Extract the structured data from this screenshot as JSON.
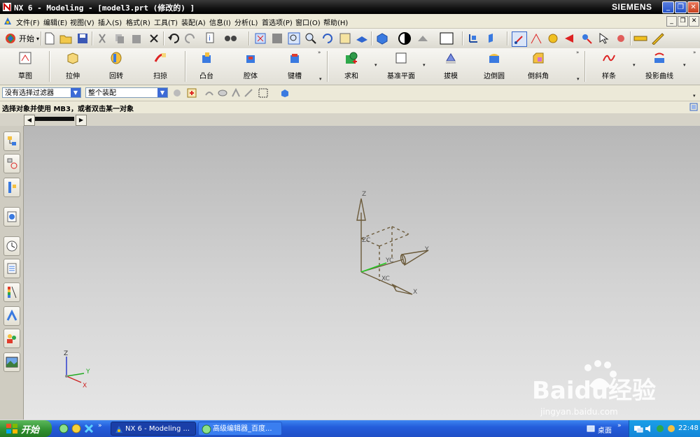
{
  "window": {
    "title": "NX 6 - Modeling - [model3.prt  (修改的) ]",
    "brand": "SIEMENS",
    "controls": {
      "minimize": "_",
      "restore": "❐",
      "close": "✕"
    }
  },
  "menu": {
    "items": [
      "文件(F)",
      "编辑(E)",
      "视图(V)",
      "插入(S)",
      "格式(R)",
      "工具(T)",
      "装配(A)",
      "信息(I)",
      "分析(L)",
      "首选项(P)",
      "窗口(O)",
      "帮助(H)"
    ],
    "mdi_controls": {
      "minimize": "_",
      "restore": "❐",
      "close": "✕"
    }
  },
  "standard_toolbar": {
    "start_label": "开始",
    "start_arrow": "▾",
    "icons": [
      "new-icon",
      "open-icon",
      "save-icon",
      "cut-icon",
      "copy-icon",
      "paste-icon",
      "delete-icon",
      "undo-icon",
      "redo-icon",
      "information-icon",
      "find-icon",
      "fit-icon",
      "zoom-window-icon",
      "zoom-icon",
      "zoom-in-out-icon",
      "rotate-icon",
      "pan-icon",
      "perspective-icon",
      "view-orient-icon",
      "shaded-icon",
      "wireframe-icon",
      "background-icon",
      "csys-icon",
      "datum-icon",
      "snap-icon",
      "point-icon",
      "select-icon",
      "measure-icon",
      "ruler-icon"
    ]
  },
  "feature_toolbar": {
    "items": [
      "草图",
      "拉伸",
      "回转",
      "扫掠",
      "凸台",
      "腔体",
      "键槽",
      "求和",
      "基准平面",
      "拔模",
      "边倒圆",
      "倒斜角",
      "样条",
      "投影曲线"
    ],
    "overflow": "»",
    "dropdown": "▾"
  },
  "selection_bar": {
    "filter_value": "没有选择过滤器",
    "scope_value": "整个装配",
    "arrow": "▼"
  },
  "cue_line": {
    "text": "选择对象并使用 MB3，或者双击某一对象"
  },
  "tab_strip": {
    "prev": "◀",
    "next": "▶"
  },
  "resource_bar": {
    "icons": [
      "assembly-navigator-icon",
      "constraint-navigator-icon",
      "part-navigator-icon",
      "internet-explorer-icon",
      "history-icon",
      "reuse-library-icon",
      "system-materials-icon",
      "process-studio-icon",
      "roles-icon",
      "system-scenes-icon"
    ]
  },
  "viewport": {
    "wcs": {
      "z": "Z",
      "y": "Y",
      "x": "X",
      "zc": "ZC",
      "yc": "YC",
      "xc": "XC"
    },
    "triad": {
      "z": "Z",
      "y": "Y",
      "x": "X"
    },
    "watermark": {
      "logo": "Baidu经验",
      "url": "jingyan.baidu.com"
    }
  },
  "taskbar": {
    "start": "开始",
    "tasks": [
      {
        "label": "NX 6 - Modeling ..."
      },
      {
        "label": "高级编辑器_百度..."
      }
    ],
    "desktop": "桌面",
    "overflow": "»",
    "clock": "22:48"
  },
  "colors": {
    "title_bar": "#1a1a1a",
    "menu_bg": "#ece9d8",
    "viewport_top": "#b7b7b7",
    "viewport_bottom": "#e6e6e6",
    "csys_line": "#6b5a3a",
    "axis_x": "#cc2222",
    "axis_y": "#22aa22",
    "axis_z": "#2233cc",
    "taskbar": "#245ddb",
    "start_button": "#2f8f2f"
  }
}
